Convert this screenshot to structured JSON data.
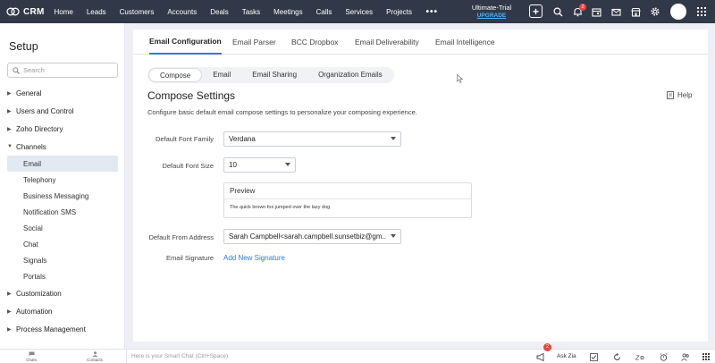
{
  "topbar": {
    "logo_text": "CRM",
    "nav": [
      "Home",
      "Leads",
      "Customers",
      "Accounts",
      "Deals",
      "Tasks",
      "Meetings",
      "Calls",
      "Services",
      "Projects"
    ],
    "more": "•••",
    "trial_label": "Ultimate-Trial",
    "upgrade_label": "UPGRADE",
    "notification_count": "2",
    "icons": [
      "plus-icon",
      "search-icon",
      "bell-icon",
      "calendar-icon",
      "mail-icon",
      "store-icon",
      "gear-icon",
      "apps-grid-icon"
    ]
  },
  "sidebar": {
    "title": "Setup",
    "search_placeholder": "Search",
    "items": [
      {
        "label": "General",
        "type": "group"
      },
      {
        "label": "Users and Control",
        "type": "group"
      },
      {
        "label": "Zoho Directory",
        "type": "group"
      },
      {
        "label": "Channels",
        "type": "group-open"
      },
      {
        "label": "Email",
        "type": "sub",
        "active": true
      },
      {
        "label": "Telephony",
        "type": "sub"
      },
      {
        "label": "Business Messaging",
        "type": "sub"
      },
      {
        "label": "Notification SMS",
        "type": "sub"
      },
      {
        "label": "Social",
        "type": "sub"
      },
      {
        "label": "Chat",
        "type": "sub"
      },
      {
        "label": "Signals",
        "type": "sub"
      },
      {
        "label": "Portals",
        "type": "sub"
      },
      {
        "label": "Customization",
        "type": "group"
      },
      {
        "label": "Automation",
        "type": "group"
      },
      {
        "label": "Process Management",
        "type": "group"
      }
    ]
  },
  "main": {
    "tabs": [
      "Email Configuration",
      "Email Parser",
      "BCC Dropbox",
      "Email Deliverability",
      "Email Intelligence"
    ],
    "active_tab": "Email Configuration",
    "subtabs": [
      "Compose",
      "Email",
      "Email Sharing",
      "Organization Emails"
    ],
    "active_subtab": "Compose",
    "section_title": "Compose Settings",
    "help_label": "Help",
    "description": "Configure basic default email compose settings to personalize your composing experience.",
    "fields": {
      "font_family_label": "Default Font Family",
      "font_family_value": "Verdana",
      "font_size_label": "Default Font Size",
      "font_size_value": "10",
      "preview_title": "Preview",
      "preview_text": "The quick brown fox jumped over the lazy dog",
      "from_address_label": "Default From Address",
      "from_address_value": "Sarah Campbell<sarah.campbell.sunsetbiz@gm...",
      "signature_label": "Email Signature",
      "signature_link": "Add New Signature"
    }
  },
  "bottombar": {
    "chats_label": "Chats",
    "contacts_label": "Contacts",
    "smart_chat_placeholder": "Here is your Smart Chat (Ctrl+Space)",
    "ask_zia": "Ask Zia",
    "announcement_count": "2"
  },
  "colors": {
    "topbar_bg": "#313949",
    "accent": "#2d7be0",
    "badge": "#e9453d"
  }
}
